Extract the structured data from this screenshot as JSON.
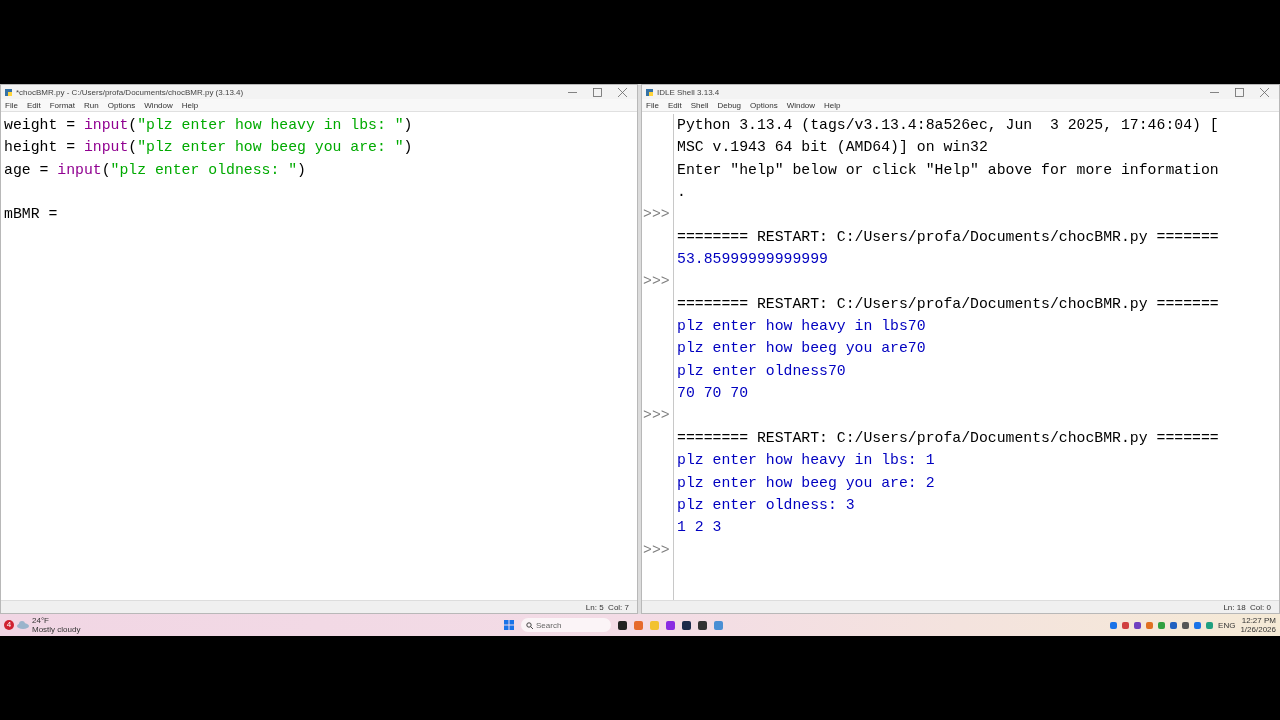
{
  "editor": {
    "title": "*chocBMR.py - C:/Users/profa/Documents/chocBMR.py (3.13.4)",
    "menu": [
      "File",
      "Edit",
      "Format",
      "Run",
      "Options",
      "Window",
      "Help"
    ],
    "lines": [
      {
        "kind": "code",
        "tokens": [
          {
            "kind": "plain",
            "text": "weight = "
          },
          {
            "kind": "builtin",
            "text": "input"
          },
          {
            "kind": "plain",
            "text": "("
          },
          {
            "kind": "string",
            "text": "\"plz enter how heavy in lbs: \""
          },
          {
            "kind": "plain",
            "text": ")"
          }
        ]
      },
      {
        "kind": "code",
        "tokens": [
          {
            "kind": "plain",
            "text": "height = "
          },
          {
            "kind": "builtin",
            "text": "input"
          },
          {
            "kind": "plain",
            "text": "("
          },
          {
            "kind": "string",
            "text": "\"plz enter how beeg you are: \""
          },
          {
            "kind": "plain",
            "text": ")"
          }
        ]
      },
      {
        "kind": "code",
        "tokens": [
          {
            "kind": "plain",
            "text": "age = "
          },
          {
            "kind": "builtin",
            "text": "input"
          },
          {
            "kind": "plain",
            "text": "("
          },
          {
            "kind": "string",
            "text": "\"plz enter oldness: \""
          },
          {
            "kind": "plain",
            "text": ")"
          }
        ]
      },
      {
        "kind": "blank"
      },
      {
        "kind": "code",
        "tokens": [
          {
            "kind": "plain",
            "text": "mBMR = "
          }
        ]
      }
    ],
    "status": "Ln: 5  Col: 7"
  },
  "shell": {
    "title": "IDLE Shell 3.13.4",
    "menu": [
      "File",
      "Edit",
      "Shell",
      "Debug",
      "Options",
      "Window",
      "Help"
    ],
    "lines": [
      {
        "kind": "info",
        "text": "Python 3.13.4 (tags/v3.13.4:8a526ec, Jun  3 2025, 17:46:04) ["
      },
      {
        "kind": "info",
        "text": "MSC v.1943 64 bit (AMD64)] on win32"
      },
      {
        "kind": "info",
        "text": "Enter \"help\" below or click \"Help\" above for more information"
      },
      {
        "kind": "info",
        "text": "."
      },
      {
        "prompt": ">>>",
        "kind": "info"
      },
      {
        "kind": "info",
        "text": "======== RESTART: C:/Users/profa/Documents/chocBMR.py ======="
      },
      {
        "kind": "output",
        "text": "53.85999999999999"
      },
      {
        "prompt": ">>>",
        "kind": "info"
      },
      {
        "kind": "info",
        "text": "======== RESTART: C:/Users/profa/Documents/chocBMR.py ======="
      },
      {
        "kind": "output",
        "text": "plz enter how heavy in lbs70"
      },
      {
        "kind": "output",
        "text": "plz enter how beeg you are70"
      },
      {
        "kind": "output",
        "text": "plz enter oldness70"
      },
      {
        "kind": "output",
        "text": "70 70 70"
      },
      {
        "prompt": ">>>",
        "kind": "info"
      },
      {
        "kind": "info",
        "text": "======== RESTART: C:/Users/profa/Documents/chocBMR.py ======="
      },
      {
        "kind": "output",
        "text": "plz enter how heavy in lbs: 1"
      },
      {
        "kind": "output",
        "text": "plz enter how beeg you are: 2"
      },
      {
        "kind": "output",
        "text": "plz enter oldness: 3"
      },
      {
        "kind": "output",
        "text": "1 2 3"
      },
      {
        "prompt": ">>>",
        "kind": "info"
      }
    ],
    "status": "Ln: 18  Col: 0"
  },
  "taskbar": {
    "weather": {
      "badge": "4",
      "temp": "24°F",
      "condition": "Mostly cloudy"
    },
    "search": {
      "placeholder": "Search"
    },
    "language": "ENG",
    "time": "12:27 PM",
    "date": "1/26/2026"
  }
}
